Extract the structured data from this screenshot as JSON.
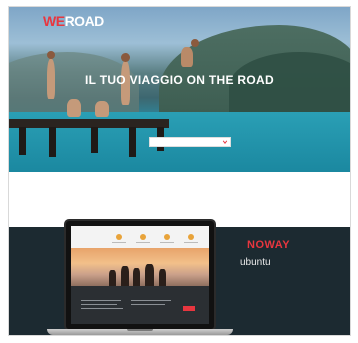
{
  "header": {
    "logo_we": "WE",
    "logo_road": "ROAD",
    "nav": [
      "",
      "",
      "",
      "",
      ""
    ]
  },
  "hero": {
    "title": "IL TUO VIAGGIO ON THE ROAD",
    "subtitle": "",
    "search_placeholder": ""
  },
  "tagline": {
    "text": ""
  },
  "section": {
    "title": "",
    "body": ""
  },
  "promo": {
    "brand": "NOWAY",
    "os": "ubuntu",
    "background_text": ""
  },
  "laptop": {
    "mini_logo": "",
    "cta_text": ""
  },
  "colors": {
    "accent": "#e8363f",
    "dark_band": "#1c2a31"
  }
}
